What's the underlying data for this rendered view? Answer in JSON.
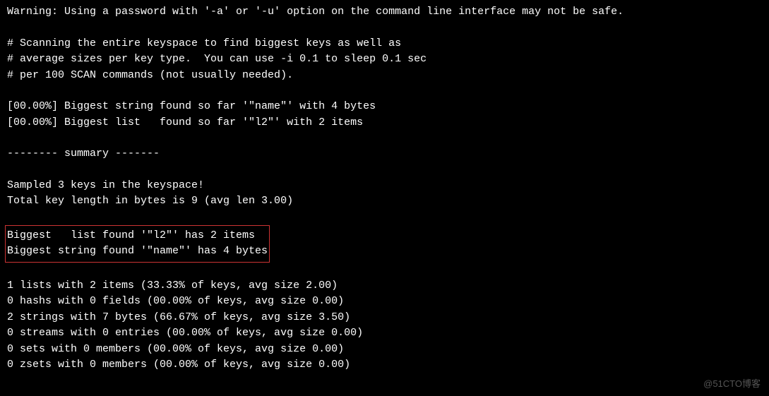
{
  "lines": {
    "warning": "Warning: Using a password with '-a' or '-u' option on the command line interface may not be safe.",
    "scan1": "# Scanning the entire keyspace to find biggest keys as well as",
    "scan2": "# average sizes per key type.  You can use -i 0.1 to sleep 0.1 sec",
    "scan3": "# per 100 SCAN commands (not usually needed).",
    "progress1": "[00.00%] Biggest string found so far '\"name\"' with 4 bytes",
    "progress2": "[00.00%] Biggest list   found so far '\"l2\"' with 2 items",
    "summary_header": "-------- summary -------",
    "sampled": "Sampled 3 keys in the keyspace!",
    "totallen": "Total key length in bytes is 9 (avg len 3.00)",
    "biggest_list": "Biggest   list found '\"l2\"' has 2 items",
    "biggest_string": "Biggest string found '\"name\"' has 4 bytes",
    "stat_lists": "1 lists with 2 items (33.33% of keys, avg size 2.00)",
    "stat_hashs": "0 hashs with 0 fields (00.00% of keys, avg size 0.00)",
    "stat_strings": "2 strings with 7 bytes (66.67% of keys, avg size 3.50)",
    "stat_streams": "0 streams with 0 entries (00.00% of keys, avg size 0.00)",
    "stat_sets": "0 sets with 0 members (00.00% of keys, avg size 0.00)",
    "stat_zsets": "0 zsets with 0 members (00.00% of keys, avg size 0.00)"
  },
  "watermark": "@51CTO博客"
}
